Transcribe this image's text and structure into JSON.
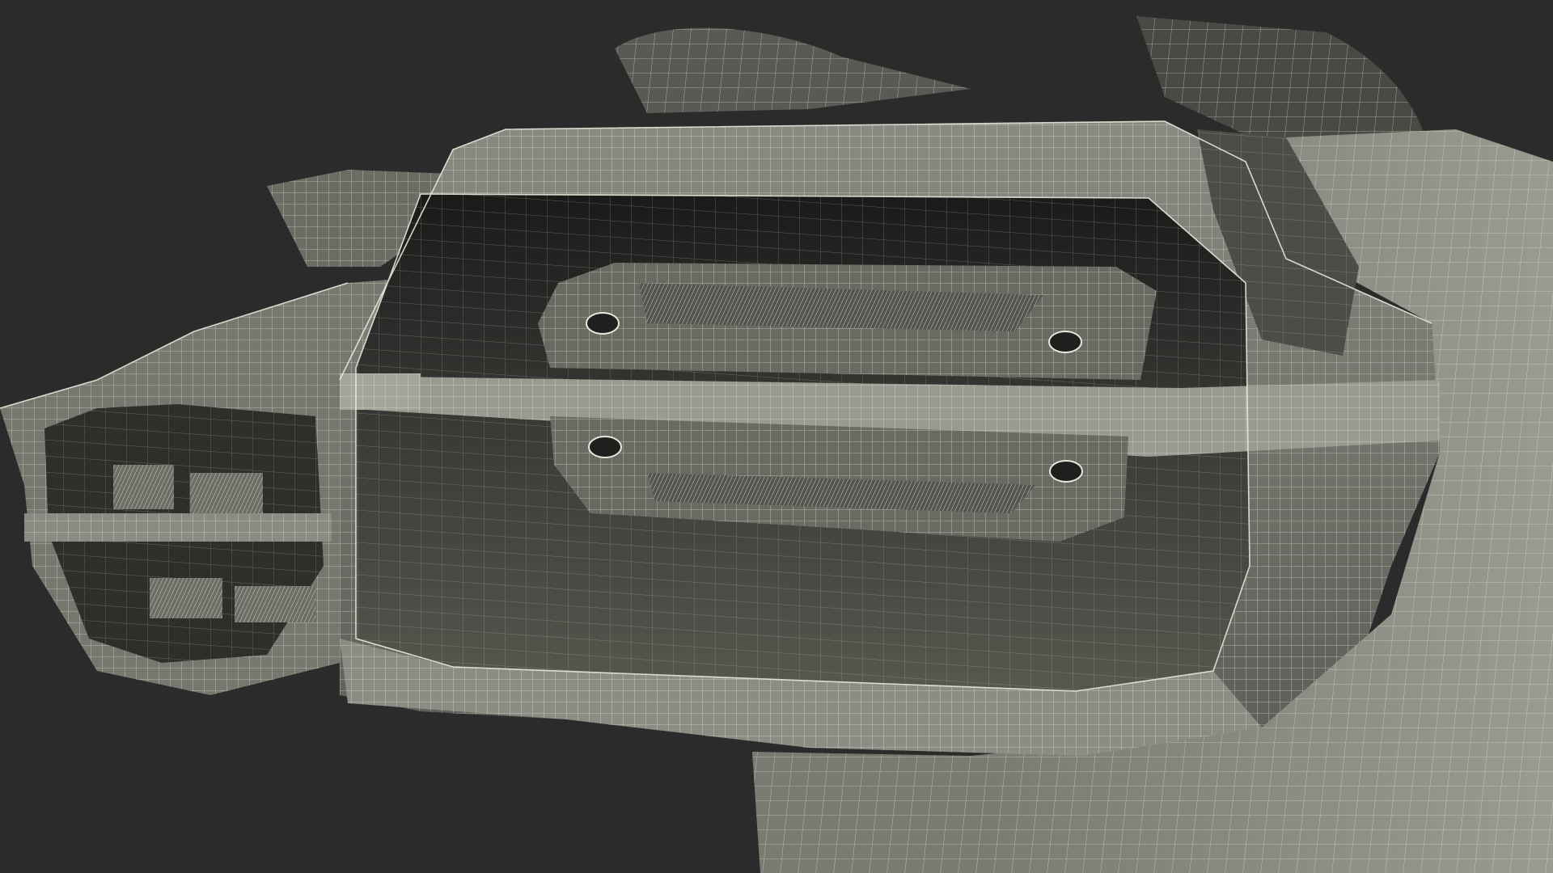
{
  "scene": {
    "subject": "wireframe-render-vehicle-tail-light",
    "colors": {
      "background": "#2b2b2b",
      "surface_light": "#8f8f86",
      "surface_mid": "#6c6c65",
      "surface_dark": "#3a3a37",
      "cavity": "#1c1c1b",
      "wire": "#e8e8dc"
    }
  }
}
